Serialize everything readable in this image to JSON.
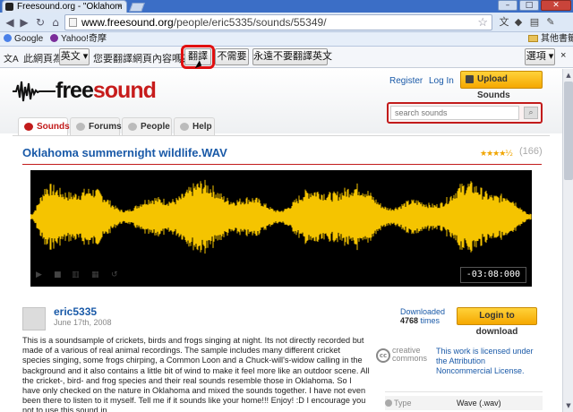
{
  "browser": {
    "tab_title": "Freesound.org - \"Oklahom",
    "tab_close": "×",
    "window_buttons": [
      "–",
      "□",
      "✕"
    ],
    "url_host": "www.freesound.org",
    "url_path": "/people/eric5335/sounds/55349/",
    "bookmarks": [
      {
        "label": "Google",
        "color": "#4a80e8"
      },
      {
        "label": "Yahoo!奇摩",
        "color": "#7b2d9a"
      }
    ],
    "other_bookmarks": "其他書籤"
  },
  "translate_bar": {
    "prefix": "此網頁為",
    "language": "英文",
    "question": "您要翻譯網頁內容嗎？",
    "translate_button": "翻譯",
    "no_button": "不需要",
    "never_button": "永遠不要翻譯英文",
    "options_button": "選項"
  },
  "site": {
    "logo_free": "free",
    "logo_sound": "sound",
    "register": "Register",
    "login": "Log In",
    "upload": "Upload Sounds",
    "search_placeholder": "search sounds",
    "tabs": [
      {
        "label": "Sounds",
        "active": true
      },
      {
        "label": "Forums",
        "active": false
      },
      {
        "label": "People",
        "active": false
      },
      {
        "label": "Help",
        "active": false
      }
    ]
  },
  "sound": {
    "title": "Oklahoma summernight wildlife.WAV",
    "stars": "★★★★½",
    "rating_count": "(166)",
    "timecode": "-03:08:000",
    "username": "eric5335",
    "date": "June 17th, 2008",
    "downloaded_label": "Downloaded",
    "downloaded_count": "4768",
    "downloaded_suffix": "times",
    "login_to_download": "Login to download",
    "description": "This is a soundsample of crickets, birds and frogs singing at night. Its not directly recorded but made of a various of real animal recordings. The sample includes many different cricket species singing, some frogs chirping, a Common Loon and a Chuck-will's-widow calling in the background and it also contains a little bit of wind to make it feel more like an outdoor scene. All the cricket-, bird- and frog species and their real sounds resemble those in Oklahoma. So I have only checked on the nature in Oklahoma and mixed the sounds together. I have not even been there to listen to it myself. Tell me if it sounds like your home!!! Enjoy! :D I encourage you not to use this sound in",
    "cc_text_1": "creative",
    "cc_text_2": "commons",
    "license_text": "This work is licensed under the Attribution Noncommercial License.",
    "info_key": "Type",
    "info_value": "Wave (.wav)"
  },
  "colors": {
    "accent_red": "#c21b1b",
    "link_blue": "#1a5aa8",
    "waveform": "#f5c400",
    "button_yellow": "#f5a800"
  }
}
